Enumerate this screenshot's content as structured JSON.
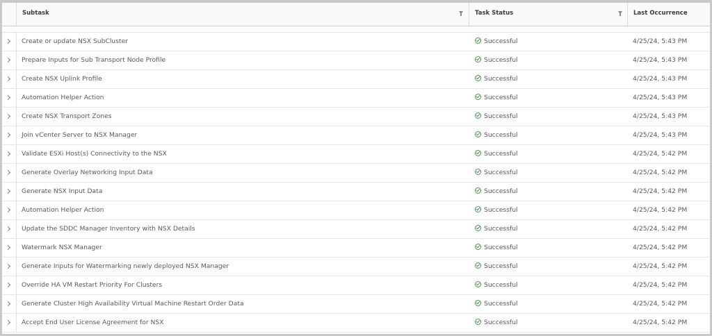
{
  "table": {
    "columns": {
      "subtask": "Subtask",
      "task_status": "Task Status",
      "last_occurrence": "Last Occurrence"
    },
    "rows": [
      {
        "subtask": "Create or update NSX SubCluster",
        "status": "Successful",
        "last": "4/25/24, 5:43 PM"
      },
      {
        "subtask": "Prepare Inputs for Sub Transport Node Profile",
        "status": "Successful",
        "last": "4/25/24, 5:43 PM"
      },
      {
        "subtask": "Create NSX Uplink Profile",
        "status": "Successful",
        "last": "4/25/24, 5:43 PM"
      },
      {
        "subtask": "Automation Helper Action",
        "status": "Successful",
        "last": "4/25/24, 5:43 PM"
      },
      {
        "subtask": "Create NSX Transport Zones",
        "status": "Successful",
        "last": "4/25/24, 5:43 PM"
      },
      {
        "subtask": "Join vCenter Server to NSX Manager",
        "status": "Successful",
        "last": "4/25/24, 5:43 PM"
      },
      {
        "subtask": "Validate ESXi Host(s) Connectivity to the NSX",
        "status": "Successful",
        "last": "4/25/24, 5:42 PM"
      },
      {
        "subtask": "Generate Overlay Networking Input Data",
        "status": "Successful",
        "last": "4/25/24, 5:42 PM"
      },
      {
        "subtask": "Generate NSX Input Data",
        "status": "Successful",
        "last": "4/25/24, 5:42 PM"
      },
      {
        "subtask": "Automation Helper Action",
        "status": "Successful",
        "last": "4/25/24, 5:42 PM"
      },
      {
        "subtask": "Update the SDDC Manager Inventory with NSX Details",
        "status": "Successful",
        "last": "4/25/24, 5:42 PM"
      },
      {
        "subtask": "Watermark NSX Manager",
        "status": "Successful",
        "last": "4/25/24, 5:42 PM"
      },
      {
        "subtask": "Generate Inputs for Watermarking newly deployed NSX Manager",
        "status": "Successful",
        "last": "4/25/24, 5:42 PM"
      },
      {
        "subtask": "Override HA VM Restart Priority For Clusters",
        "status": "Successful",
        "last": "4/25/24, 5:42 PM"
      },
      {
        "subtask": "Generate Cluster High Availability Virtual Machine Restart Order Data",
        "status": "Successful",
        "last": "4/25/24, 5:42 PM"
      },
      {
        "subtask": "Accept End User License Agreement for NSX",
        "status": "Successful",
        "last": "4/25/24, 5:42 PM"
      }
    ]
  },
  "icons": {
    "expand": "chevron-right-icon",
    "filter": "filter-icon",
    "status_ok": "check-circle-icon"
  },
  "colors": {
    "success": "#3f9a3f"
  }
}
